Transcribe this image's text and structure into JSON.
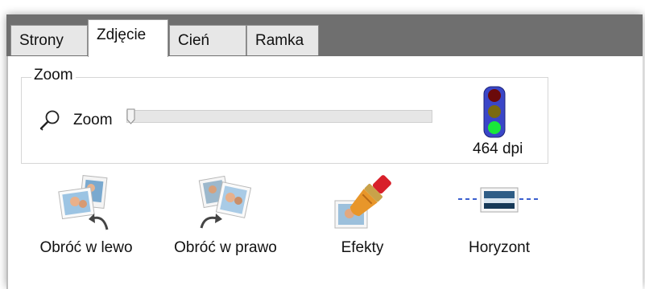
{
  "tabs": [
    {
      "label": "Strony"
    },
    {
      "label": "Zdjęcie"
    },
    {
      "label": "Cień"
    },
    {
      "label": "Ramka"
    }
  ],
  "active_tab": "Zdjęcie",
  "zoom": {
    "group_title": "Zoom",
    "label": "Zoom",
    "icon": "magnifier-icon",
    "slider_value": 0,
    "dpi_text": "464 dpi",
    "quality_light": {
      "icon": "traffic-light-icon",
      "lit": "green"
    }
  },
  "actions": [
    {
      "label": "Obróć w lewo",
      "icon": "rotate-left-icon"
    },
    {
      "label": "Obróć w prawo",
      "icon": "rotate-right-icon"
    },
    {
      "label": "Efekty",
      "icon": "effects-brush-icon"
    },
    {
      "label": "Horyzont",
      "icon": "horizon-icon"
    }
  ],
  "colors": {
    "tab_strip": "#6f6f6f",
    "tab_inactive": "#e7e7e7",
    "slider_track": "#e6e6e6",
    "light_red": "#6b0a0a",
    "light_amber": "#7a6a10",
    "light_green": "#18e83a"
  }
}
